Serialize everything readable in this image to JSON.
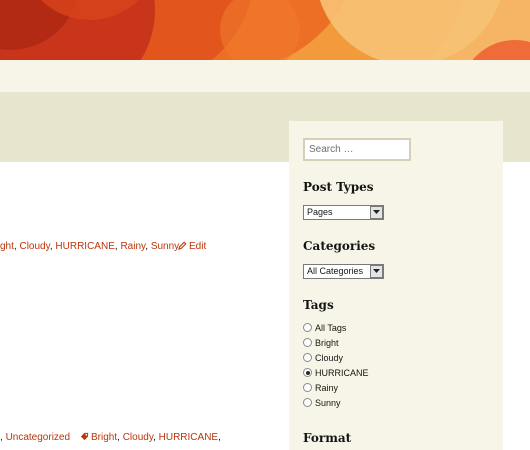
{
  "post_meta": {
    "first_tags": [
      "ght",
      "Cloudy",
      "HURRICANE",
      "Rainy",
      "Sunny"
    ],
    "edit_label": "Edit",
    "second_categories": [
      "",
      "Uncategorized"
    ],
    "second_tags": [
      "Bright",
      "Cloudy",
      "HURRICANE",
      ""
    ]
  },
  "sidebar": {
    "search_placeholder": "Search …",
    "post_types": {
      "title": "Post Types",
      "selected": "Pages"
    },
    "categories": {
      "title": "Categories",
      "selected": "All Categories"
    },
    "tags": {
      "title": "Tags",
      "options": [
        "All Tags",
        "Bright",
        "Cloudy",
        "HURRICANE",
        "Rainy",
        "Sunny"
      ],
      "selected_index": 3
    },
    "format": {
      "title": "Format"
    }
  },
  "colors": {
    "link": "#bc360a",
    "sidebar_bg": "#f7f5e7",
    "band_bg": "#e8e5ce"
  }
}
